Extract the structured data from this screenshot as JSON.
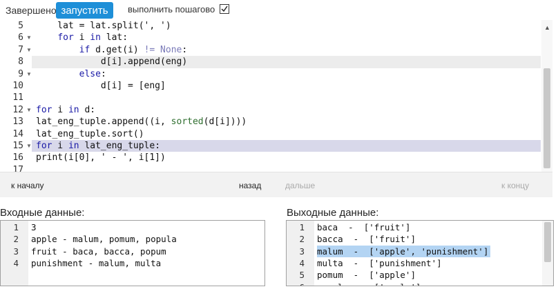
{
  "toolbar": {
    "status": "Завершено",
    "run_label": "запустить",
    "step_label": "выполнить пошагово",
    "step_checked": true
  },
  "editor": {
    "lines": [
      {
        "n": "5",
        "fold": false,
        "text": "        lat = lat.split(', ')"
      },
      {
        "n": "6",
        "fold": true,
        "text": "        for i in lat:"
      },
      {
        "n": "7",
        "fold": true,
        "text": "            if d.get(i) != None:"
      },
      {
        "n": "8",
        "fold": false,
        "text": "                d[i].append(eng)"
      },
      {
        "n": "9",
        "fold": true,
        "text": "            else:"
      },
      {
        "n": "10",
        "fold": false,
        "text": "                d[i] = [eng]"
      },
      {
        "n": "11",
        "fold": false,
        "text": ""
      },
      {
        "n": "12",
        "fold": true,
        "text": "for i in d:"
      },
      {
        "n": "13",
        "fold": false,
        "text": "    lat_eng_tuple.append((i, sorted(d[i])))"
      },
      {
        "n": "14",
        "fold": false,
        "text": "lat_eng_tuple.sort()"
      },
      {
        "n": "15",
        "fold": true,
        "text": "for i in lat_eng_tuple:"
      },
      {
        "n": "16",
        "fold": false,
        "text": "    print(i[0], ' - ', i[1])"
      },
      {
        "n": "17",
        "fold": false,
        "text": ""
      }
    ],
    "active_line": "8",
    "step_line": "15"
  },
  "nav": {
    "start": "к началу",
    "back": "назад",
    "next": "дальше",
    "end": "к концу"
  },
  "input_panel": {
    "title": "Входные данные:",
    "lines": [
      "3",
      "apple - malum, pomum, popula",
      "fruit - baca, bacca, popum",
      "punishment - malum, multa"
    ]
  },
  "output_panel": {
    "title": "Выходные данные:",
    "lines": [
      "baca  -  ['fruit']",
      "bacca  -  ['fruit']",
      "malum  -  ['apple', 'punishment']",
      "multa  -  ['punishment']",
      "pomum  -  ['apple']",
      "popula  -  ['apple']"
    ],
    "selected_line": 3
  }
}
